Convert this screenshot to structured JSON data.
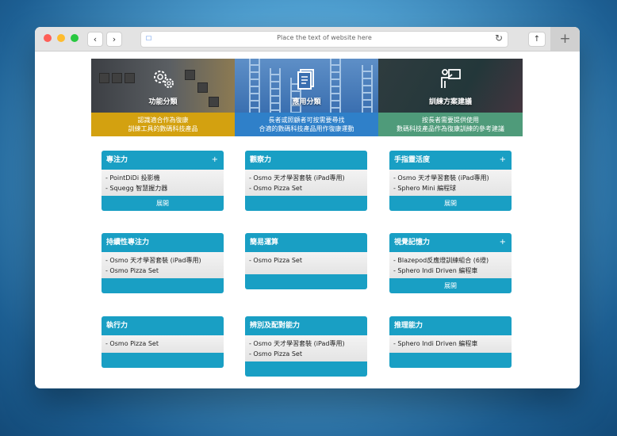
{
  "browser": {
    "url_placeholder": "Place the text of website here",
    "back_icon": "‹",
    "forward_icon": "›",
    "new_tab_icon": "+",
    "share_icon": "↑",
    "reload_icon": "↻",
    "lock_icon": "🔒"
  },
  "banners": [
    {
      "title": "功能分類",
      "caption_line1": "認識適合作為復康",
      "caption_line2": "訓練工具的數碼科技產品",
      "icon": "gears-icon"
    },
    {
      "title": "應用分類",
      "caption_line1": "長者或照顧者可按需要尋找",
      "caption_line2": "合適的數碼科技產品用作復康運動",
      "icon": "document-icon"
    },
    {
      "title": "訓練方案建議",
      "caption_line1": "按長者需要提供使用",
      "caption_line2": "數碼科技產品作為復康訓練的參考建議",
      "icon": "presenter-icon"
    }
  ],
  "cards": [
    {
      "title": "專注力",
      "plus": "+",
      "items": [
        "- PointDiDi 投影機",
        "- Squegg 智慧握力器"
      ],
      "footer": "展開"
    },
    {
      "title": "觀察力",
      "plus": "",
      "items": [
        "- Osmo 天才學習套裝 (iPad專用)",
        "- Osmo Pizza Set"
      ],
      "footer": ""
    },
    {
      "title": "手指靈活度",
      "plus": "+",
      "items": [
        "- Osmo 天才學習套裝 (iPad專用)",
        "- Sphero Mini 編程球"
      ],
      "footer": "展開"
    },
    {
      "title": "持續性專注力",
      "plus": "",
      "items": [
        "- Osmo 天才學習套裝 (iPad專用)",
        "- Osmo Pizza Set"
      ],
      "footer": ""
    },
    {
      "title": "簡易運算",
      "plus": "",
      "items": [
        "- Osmo Pizza Set"
      ],
      "footer": ""
    },
    {
      "title": "視覺記憶力",
      "plus": "+",
      "items": [
        "- Blazepod反應燈訓練組合 (6燈)",
        "- Sphero Indi Driven 編程車"
      ],
      "footer": "展開"
    },
    {
      "title": "執行力",
      "plus": "",
      "items": [
        "- Osmo Pizza Set"
      ],
      "footer": ""
    },
    {
      "title": "辨別及配對能力",
      "plus": "",
      "items": [
        "- Osmo 天才學習套裝 (iPad專用)",
        "- Osmo Pizza Set"
      ],
      "footer": ""
    },
    {
      "title": "推理能力",
      "plus": "",
      "items": [
        "- Sphero Indi Driven 編程車"
      ],
      "footer": ""
    }
  ]
}
